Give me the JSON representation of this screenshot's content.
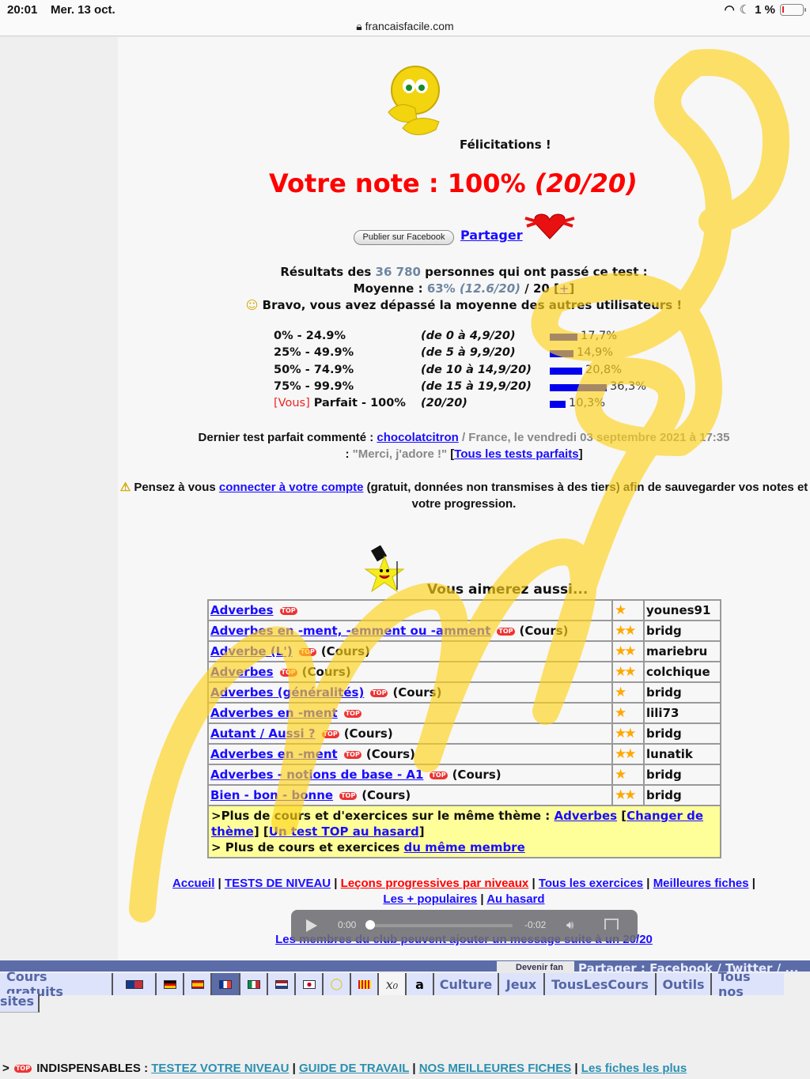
{
  "status_bar": {
    "time": "20:01",
    "date": "Mer. 13 oct.",
    "url": "francaisfacile.com",
    "battery": "1 %",
    "icons": [
      "wifi-icon",
      "moon-icon",
      "battery-icon"
    ]
  },
  "result": {
    "congrats": "Félicitations !",
    "note_label": "Votre note : 100% ",
    "note_score": "(20/20)",
    "facebook_button": "Publier sur Facebook",
    "share_link": "Partager"
  },
  "stats": {
    "results_prefix": "Résultats des ",
    "participants": "36 780",
    "results_suffix": " personnes qui ont passé ce test :",
    "average_label": "Moyenne : ",
    "average_pct": "63%",
    "average_score": "(12.6/20)",
    "average_suffix": " / 20 [",
    "more_link": "+",
    "close_bracket": "]",
    "bravo": "Bravo, vous avez dépassé la moyenne des autres utilisateurs !"
  },
  "distribution": [
    {
      "range": "0% - 24.9%",
      "detail": "(de 0 à 4,9/20)",
      "percent": 17.7,
      "label": "17,7%"
    },
    {
      "range": "25% - 49.9%",
      "detail": "(de 5 à 9,9/20)",
      "percent": 14.9,
      "label": "14,9%"
    },
    {
      "range": "50% - 74.9%",
      "detail": "(de 10 à 14,9/20)",
      "percent": 20.8,
      "label": "20,8%"
    },
    {
      "range": "75% - 99.9%",
      "detail": "(de 15 à 19,9/20)",
      "percent": 36.3,
      "label": "36,3%"
    },
    {
      "vous": "[Vous]",
      "range": " Parfait - 100%",
      "detail": "(20/20)",
      "percent": 10.3,
      "label": "10,3%"
    }
  ],
  "last_perfect": {
    "prefix": "Dernier test parfait commenté : ",
    "user": "chocolatcitron",
    "location": " / France, le vendredi 03 septembre 2021 à 17:35",
    "comment_prefix": ": ",
    "comment": "\"Merci, j'adore !\"",
    "open_bracket": " [",
    "all_link": "Tous les tests parfaits",
    "close_bracket": "]"
  },
  "warning": {
    "prefix": "Pensez à vous ",
    "link": "connecter à votre compte",
    "suffix": " (gratuit, données non transmises à des tiers) afin de sauvegarder vos notes et votre progression."
  },
  "recommendations": {
    "title": "Vous aimerez aussi...",
    "top_badge": "TOP",
    "rows": [
      {
        "title": "Adverbes",
        "cours": "",
        "stars": "★",
        "author": "younes91"
      },
      {
        "title": "Adverbes en -ment, -emment ou -amment",
        "cours": "(Cours)",
        "stars": "★★",
        "author": "bridg"
      },
      {
        "title": "Adverbe (L')",
        "cours": "(Cours)",
        "stars": "★★",
        "author": "mariebru"
      },
      {
        "title": "Adverbes",
        "cours": "(Cours)",
        "stars": "★★",
        "author": "colchique"
      },
      {
        "title": "Adverbes (généralités)",
        "cours": "(Cours)",
        "stars": "★",
        "author": "bridg"
      },
      {
        "title": "Adverbes en -ment",
        "cours": "",
        "stars": "★",
        "author": "lili73"
      },
      {
        "title": "Autant / Aussi ?",
        "cours": "(Cours)",
        "stars": "★★",
        "author": "bridg"
      },
      {
        "title": "Adverbes en -ment",
        "cours": "(Cours)",
        "stars": "★★",
        "author": "lunatik"
      },
      {
        "title": "Adverbes - notions de base - A1",
        "cours": "(Cours)",
        "stars": "★",
        "author": "bridg"
      },
      {
        "title": "Bien - bon - bonne",
        "cours": "(Cours)",
        "stars": "★★",
        "author": "bridg"
      }
    ],
    "more": {
      "line1_prefix": ">Plus de cours et d'exercices sur le même thème : ",
      "theme_link": "Adverbes",
      "change_link": "Changer de thème",
      "random_link": "Un test TOP au hasard",
      "line2_prefix": "> Plus de cours et exercices ",
      "member_link": "du même membre"
    }
  },
  "nav_links": {
    "accueil": "Accueil",
    "tests": "TESTS DE NIVEAU",
    "lecons": "Leçons progressives par niveaux",
    "exercices": "Tous les exercices",
    "fiches": "Meilleures fiches",
    "populaires": "Les + populaires",
    "hasard": "Au hasard",
    "sep": " | "
  },
  "audio": {
    "current": "0:00",
    "remaining": "-0:02"
  },
  "membres_link": "Les membres du club peuvent ajouter un message suite à un 20/20",
  "bottom_nav": {
    "fan": "Devenir fan",
    "share": "Partager : Facebook / Twitter / ",
    "share_more": "...",
    "cours_gratuits": "Cours gratuits",
    "flags": [
      "english-flag",
      "german-flag",
      "spanish-flag",
      "french-flag",
      "italian-flag",
      "dutch-flag",
      "japanese-flag",
      "esperanto-icon",
      "catalan-flag",
      "math-icon",
      "amazon-icon"
    ],
    "math_label": "x₀",
    "amazon_label": "a",
    "culture": "Culture",
    "jeux": "Jeux",
    "tous_cours": "TousLesCours",
    "outils": "Outils",
    "tous_nos": "Tous nos",
    "sites": "sites"
  },
  "indispensables": {
    "prefix": "> ",
    "label": " INDISPENSABLES : ",
    "testez": "TESTEZ VOTRE NIVEAU",
    "guide": "GUIDE DE TRAVAIL",
    "meilleures": "NOS MEILLEURES FICHES",
    "plus": "Les fiches les plus",
    "sep": " | "
  },
  "colors": {
    "score_red": "#ff0000",
    "link_blue": "#1a0dff",
    "bar_blue": "#0000ee",
    "stat_grey": "#6e86a0",
    "nav_blue": "#5b6ca8",
    "highlight_yellow": "#ffff99"
  }
}
